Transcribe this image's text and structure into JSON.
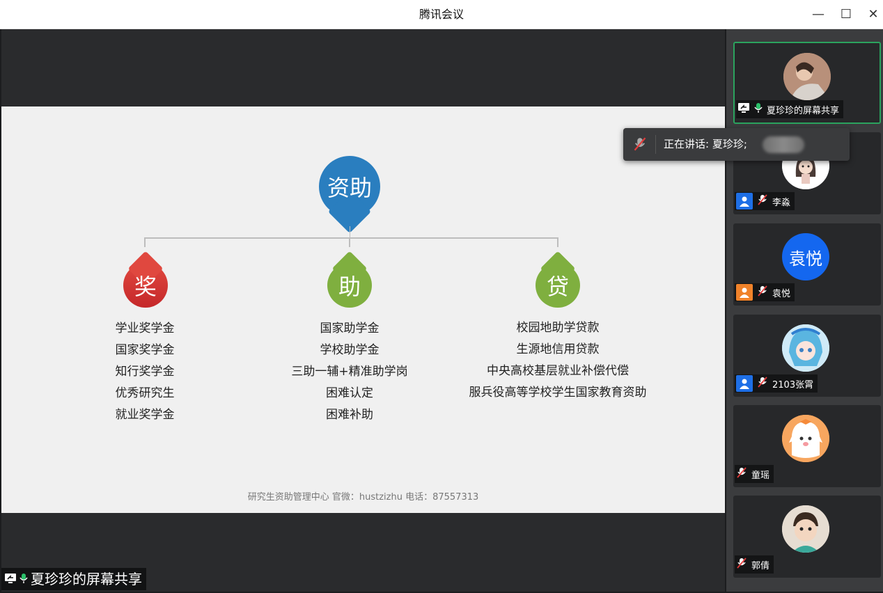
{
  "window": {
    "title": "腾讯会议",
    "minimize": "—",
    "maximize": "☐",
    "close": "✕"
  },
  "slide": {
    "root": "资助",
    "categories": [
      {
        "label": "奖",
        "items": [
          "学业奖学金",
          "国家奖学金",
          "知行奖学金",
          "优秀研究生",
          "就业奖学金"
        ]
      },
      {
        "label": "助",
        "items": [
          "国家助学金",
          "学校助学金",
          "三助一辅+精准助学岗",
          "困难认定",
          "困难补助"
        ]
      },
      {
        "label": "贷",
        "items": [
          "校园地助学贷款",
          "生源地信用贷款",
          "中央高校基层就业补偿代偿",
          "服兵役高等学校学生国家教育资助"
        ]
      }
    ],
    "footer": "研究生资助管理中心 官微：hustzizhu 电话：87557313"
  },
  "share_label": "夏珍珍的屏幕共享",
  "toast": {
    "text": "正在讲话: 夏珍珍;"
  },
  "participants": [
    {
      "name": "夏珍珍的屏幕共享",
      "badge": "share",
      "mic": "on",
      "avatar": "photo",
      "active": true
    },
    {
      "name": "李淼",
      "badge": "blue",
      "mic": "muted",
      "avatar": "cartoon"
    },
    {
      "name": "袁悦",
      "badge": "orange",
      "mic": "muted",
      "avatar": "text",
      "avatar_text": "袁悦"
    },
    {
      "name": "2103张霄",
      "badge": "blue",
      "mic": "muted",
      "avatar": "anime"
    },
    {
      "name": "童瑶",
      "badge": "none",
      "mic": "muted",
      "avatar": "bunny"
    },
    {
      "name": "郭倩",
      "badge": "none",
      "mic": "muted",
      "avatar": "baby"
    }
  ],
  "colors": {
    "accent_blue": "#2a7ebf",
    "red": "#d33a35",
    "green": "#7faf3f",
    "active_border": "#2ba35e",
    "avatar_blue": "#1467ef"
  }
}
